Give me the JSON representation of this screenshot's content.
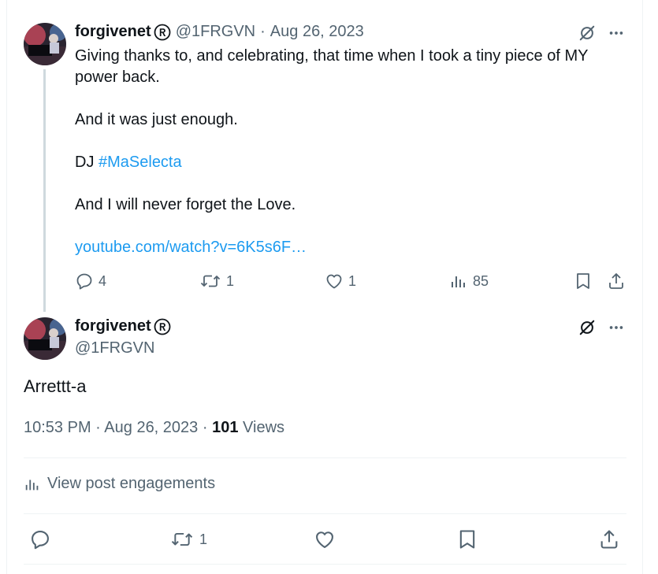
{
  "reply_parent": {
    "display_name": "forgivenet",
    "handle": "@1FRGVN",
    "separator": "·",
    "date": "Aug 26, 2023",
    "text": {
      "line1": "Giving thanks to, and celebrating, that time when I took a tiny piece of MY power back.",
      "line2": "And it was just enough.",
      "line3_prefix": "DJ ",
      "hashtag": "#MaSelecta",
      "line4": "And I will never forget the Love.",
      "link": "youtube.com/watch?v=6K5s6F…"
    },
    "stats": {
      "replies": "4",
      "reposts": "1",
      "likes": "1",
      "views": "85"
    }
  },
  "main_post": {
    "display_name": "forgivenet",
    "handle": "@1FRGVN",
    "text": "Arrettt-a",
    "time": "10:53 PM",
    "separator": "·",
    "date": "Aug 26, 2023",
    "views_count": "101",
    "views_label": "Views",
    "engagements_label": "View post engagements",
    "reposts": "1"
  },
  "icons": {
    "avatar": "avatar-piano-image",
    "grok": "grok-icon",
    "more": "more-icon",
    "reply": "reply-icon",
    "repost": "repost-icon",
    "like": "heart-icon",
    "views": "analytics-icon",
    "bookmark": "bookmark-icon",
    "share": "share-icon"
  },
  "colors": {
    "text_primary": "#0f1419",
    "text_secondary": "#536471",
    "link": "#1d9bf0",
    "divider": "#eff3f4",
    "thread_line": "#cfd9de"
  }
}
